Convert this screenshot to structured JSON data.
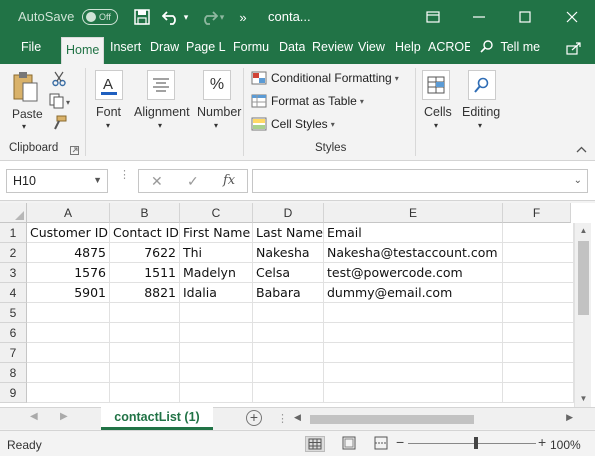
{
  "titlebar": {
    "autosave_label": "AutoSave",
    "autosave_state": "Off",
    "doc_title": "conta...",
    "more": "»"
  },
  "tabs": [
    "File",
    "Home",
    "Insert",
    "Draw",
    "Page La",
    "Formu",
    "Data",
    "Review",
    "View",
    "Help",
    "ACROE"
  ],
  "tell_me": "Tell me",
  "ribbon": {
    "clipboard": {
      "paste": "Paste",
      "group": "Clipboard"
    },
    "font": "Font",
    "alignment": "Alignment",
    "number": "Number",
    "number_glyph": "%",
    "styles": {
      "conditional_formatting": "Conditional Formatting",
      "format_as_table": "Format as Table",
      "cell_styles": "Cell Styles",
      "group": "Styles"
    },
    "cells": "Cells",
    "editing": "Editing"
  },
  "formula_bar": {
    "name_box": "H10",
    "fx": "fx",
    "formula": ""
  },
  "sheet": {
    "columns": [
      "A",
      "B",
      "C",
      "D",
      "E",
      "F"
    ],
    "rows": [
      [
        "Customer ID",
        "Contact ID",
        "First Name",
        "Last Name",
        "Email",
        ""
      ],
      [
        "4875",
        "7622",
        "Thi",
        "Nakesha",
        "Nakesha@testaccount.com",
        ""
      ],
      [
        "1576",
        "1511",
        "Madelyn",
        "Celsa",
        "test@powercode.com",
        ""
      ],
      [
        "5901",
        "8821",
        "Idalia",
        "Babara",
        "dummy@email.com",
        ""
      ],
      [
        "",
        "",
        "",
        "",
        "",
        ""
      ],
      [
        "",
        "",
        "",
        "",
        "",
        ""
      ],
      [
        "",
        "",
        "",
        "",
        "",
        ""
      ],
      [
        "",
        "",
        "",
        "",
        "",
        ""
      ],
      [
        "",
        "",
        "",
        "",
        "",
        ""
      ]
    ],
    "row_numbers": [
      "1",
      "2",
      "3",
      "4",
      "5",
      "6",
      "7",
      "8",
      "9"
    ]
  },
  "sheet_tabs": {
    "active": "contactList (1)"
  },
  "statusbar": {
    "ready": "Ready",
    "zoom": "100%"
  },
  "colors": {
    "accent": "#217346",
    "ribbon": "#f3f3f3"
  }
}
